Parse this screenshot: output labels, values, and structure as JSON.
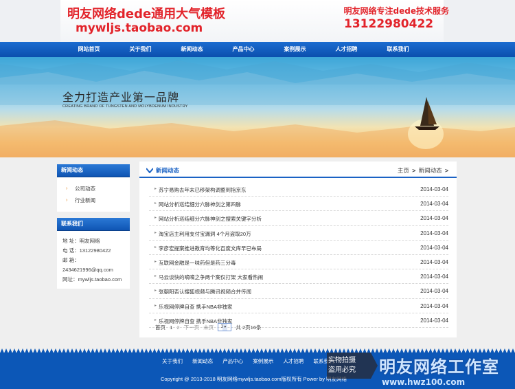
{
  "header": {
    "brand_title": "明友网络dede通用大气模板",
    "brand_url": "mywljs.taobao.com",
    "service_title": "明友网络专注dede技术服务",
    "service_phone": "13122980422"
  },
  "nav": {
    "items": [
      "网站首页",
      "关于我们",
      "新闻动态",
      "产品中心",
      "案例展示",
      "人才招聘",
      "联系我们"
    ]
  },
  "banner": {
    "slogan": "全力打造产业第一品牌",
    "slogan_en": "CREATING BRAND OF TUNGSTEN AND MOLYBDENUM INDUSTRY"
  },
  "sidebar": {
    "news_title": "新闻动态",
    "news_items": [
      "公司动态",
      "行业新闻"
    ],
    "contact_title": "联系我们",
    "contact": {
      "address": "地 址：明友网络",
      "phone": "电 话：13122980422",
      "email_label": "邮 箱：",
      "email": "2434621996@qq.com",
      "website": "网址：mywljs.taobao.com"
    }
  },
  "main": {
    "title": "新闻动态",
    "breadcrumb": [
      "主页",
      "新闻动态"
    ],
    "news": [
      {
        "title": "苏宁易购去年末已移架构调整到指京东",
        "date": "2014-03-04"
      },
      {
        "title": "网站分析巡结细分六脉神剑之第四脉",
        "date": "2014-03-04"
      },
      {
        "title": "网站分析巡结细分六脉神剑之搜索关键字分析",
        "date": "2014-03-04"
      },
      {
        "title": "淘宝店主利用支付宝漏洞 4个月盗取20万",
        "date": "2014-03-04"
      },
      {
        "title": "李彦宏提案推进教育均等化百度文库早已布局",
        "date": "2014-03-04"
      },
      {
        "title": "互联网金融是一味药但是药三分毒",
        "date": "2014-03-04"
      },
      {
        "title": "马云谈快的嘀嘀之争两个案仅打架 大家看热闹",
        "date": "2014-03-04"
      },
      {
        "title": "张朝阳否认搜狐视频与腾讯视频合并传闻",
        "date": "2014-03-04"
      },
      {
        "title": "乐视网停牌自查 携手NBA非独家",
        "date": "2014-03-04"
      },
      {
        "title": "乐视网停牌自查 携手NBA非独家",
        "date": "2014-03-04"
      }
    ],
    "pager": {
      "first": "首页",
      "page1": "1",
      "page2": "2",
      "next": "下一页",
      "last": "末页",
      "select_value": "1",
      "total": "共 2页16条"
    }
  },
  "footer": {
    "nav": [
      "关于我们",
      "新闻动态",
      "产品中心",
      "案例展示",
      "人才招聘",
      "联系我们"
    ],
    "copyright": "Copyright @ 2013-2018 明友网络mywljs.taobao.com版权所有 Power by 明友网络"
  },
  "watermark": {
    "line1": "实物拍摄",
    "line2": "盗用必究",
    "name": "明友网络工作室",
    "url": "www.hwz100.com"
  },
  "colors": {
    "brand_red": "#e2232a",
    "nav_blue": "#0b4fae",
    "footer_blue": "#0c57b7",
    "accent_orange": "#e07d10"
  }
}
